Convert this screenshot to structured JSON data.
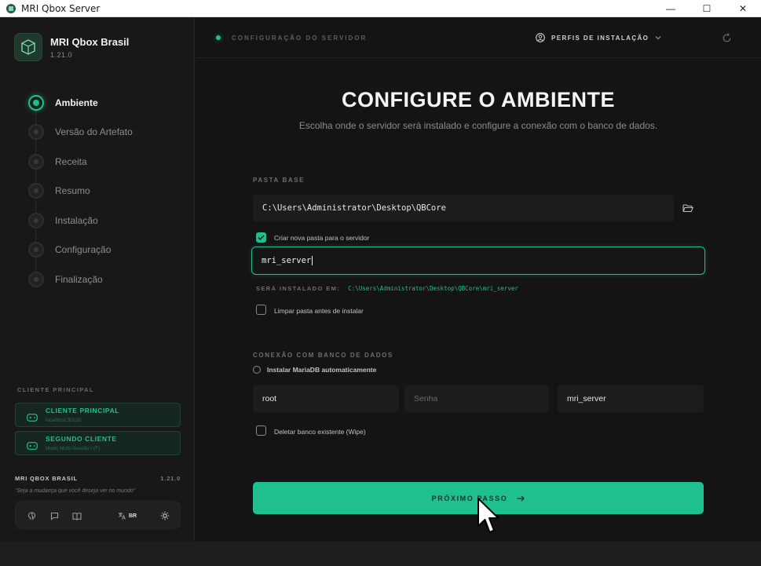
{
  "window": {
    "title": "MRI Qbox Server",
    "controls": {
      "minimize": "—",
      "maximize": "☐",
      "close": "✕"
    }
  },
  "brand": {
    "name": "MRI Qbox Brasil",
    "version": "1.21.0",
    "logo_icon": "box-logo-icon"
  },
  "steps": [
    {
      "label": "Ambiente",
      "active": true
    },
    {
      "label": "Versão do Artefato",
      "active": false
    },
    {
      "label": "Receita",
      "active": false
    },
    {
      "label": "Resumo",
      "active": false
    },
    {
      "label": "Instalação",
      "active": false
    },
    {
      "label": "Configuração",
      "active": false
    },
    {
      "label": "Finalização",
      "active": false
    }
  ],
  "clients": {
    "heading": "CLIENTE PRINCIPAL",
    "items": [
      {
        "name": "CLIENTE PRINCIPAL",
        "sub": "localhost:30120"
      },
      {
        "name": "SEGUNDO CLIENTE",
        "sub": "Modo Multi-Sessão / (F)"
      }
    ]
  },
  "footer": {
    "brand": "MRI QBOX BRASIL",
    "version": "1.21.0",
    "quote": "\"Seja a mudança que você deseja ver no mundo\"",
    "lang_label": "BR"
  },
  "topbar": {
    "title": "CONFIGURAÇÃO DO SERVIDOR",
    "profiles_label": "PERFIS DE INSTALAÇÃO"
  },
  "main": {
    "heading": "CONFIGURE O AMBIENTE",
    "subheading": "Escolha onde o servidor será instalado e configure a conexão com o banco de dados.",
    "base_folder": {
      "label": "PASTA BASE",
      "value": "C:\\Users\\Administrator\\Desktop\\QBCore"
    },
    "create_folder": {
      "label": "Criar nova pasta para o servidor",
      "checked": true
    },
    "folder_name": {
      "value": "mri_server"
    },
    "install_at": {
      "label": "SERÁ INSTALADO EM:",
      "path": "C:\\Users\\Administrator\\Desktop\\QBCore\\mri_server"
    },
    "clean_folder": {
      "label": "Limpar pasta antes de instalar",
      "checked": false
    },
    "db": {
      "label": "CONEXÃO COM BANCO DE DADOS",
      "install_mariadb": {
        "label": "Instalar MariaDB automaticamente",
        "checked": false
      },
      "user": {
        "value": "root"
      },
      "password": {
        "placeholder": "Senha",
        "value": ""
      },
      "database": {
        "value": "mri_server"
      },
      "wipe": {
        "label": "Deletar banco existente (Wipe)",
        "checked": false
      }
    },
    "next_button": {
      "label": "PRÓXIMO PASSO",
      "arrow": "→"
    }
  },
  "colors": {
    "accent": "#1fbf8f",
    "background": "#141414",
    "sidebar": "#181818",
    "field": "#1c1c1c"
  }
}
